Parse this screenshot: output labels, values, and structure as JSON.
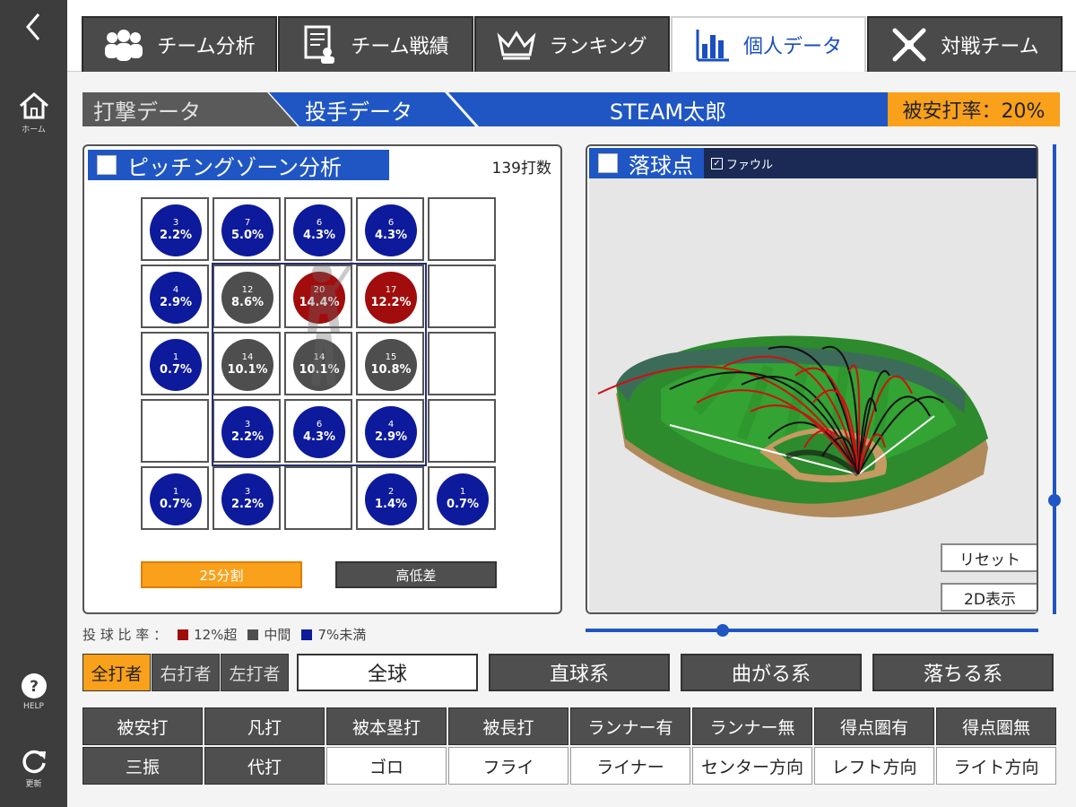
{
  "rail": {
    "home_label": "ホーム",
    "help_label": "HELP",
    "refresh_label": "更新"
  },
  "tabs": [
    {
      "label": "チーム分析",
      "icon": "team-icon"
    },
    {
      "label": "チーム戦績",
      "icon": "record-icon"
    },
    {
      "label": "ランキング",
      "icon": "crown-icon"
    },
    {
      "label": "個人データ",
      "icon": "bar-chart-icon"
    },
    {
      "label": "対戦チーム",
      "icon": "crossed-bats-icon"
    }
  ],
  "subbar": {
    "batting": "打撃データ",
    "pitching": "投手データ",
    "player": "STEAM太郎",
    "rate": "被安打率：20%"
  },
  "zone": {
    "title": "ピッチングゾーン分析",
    "count": "139打数",
    "rows": [
      [
        {
          "n": "3",
          "p": "2.2%",
          "c": "blue"
        },
        {
          "n": "7",
          "p": "5.0%",
          "c": "blue"
        },
        {
          "n": "6",
          "p": "4.3%",
          "c": "blue"
        },
        {
          "n": "6",
          "p": "4.3%",
          "c": "blue"
        },
        null
      ],
      [
        {
          "n": "4",
          "p": "2.9%",
          "c": "blue"
        },
        {
          "n": "12",
          "p": "8.6%",
          "c": "gray"
        },
        {
          "n": "20",
          "p": "14.4%",
          "c": "red"
        },
        {
          "n": "17",
          "p": "12.2%",
          "c": "red"
        },
        null
      ],
      [
        {
          "n": "1",
          "p": "0.7%",
          "c": "blue"
        },
        {
          "n": "14",
          "p": "10.1%",
          "c": "gray"
        },
        {
          "n": "14",
          "p": "10.1%",
          "c": "gray"
        },
        {
          "n": "15",
          "p": "10.8%",
          "c": "gray"
        },
        null
      ],
      [
        null,
        {
          "n": "3",
          "p": "2.2%",
          "c": "blue"
        },
        {
          "n": "6",
          "p": "4.3%",
          "c": "blue"
        },
        {
          "n": "4",
          "p": "2.9%",
          "c": "blue"
        },
        null
      ],
      [
        {
          "n": "1",
          "p": "0.7%",
          "c": "blue"
        },
        {
          "n": "3",
          "p": "2.2%",
          "c": "blue"
        },
        null,
        {
          "n": "2",
          "p": "1.4%",
          "c": "blue"
        },
        {
          "n": "1",
          "p": "0.7%",
          "c": "blue"
        }
      ]
    ],
    "btn_25": "25分割",
    "btn_height": "高低差"
  },
  "landing": {
    "title": "落球点",
    "foul_label": "ファウル",
    "foul_checked": true,
    "reset": "リセット",
    "view2d": "2D表示"
  },
  "legend": {
    "prefix": "投 球 比 率 ：",
    "over": "12%超",
    "middle": "中間",
    "under": "7%未満"
  },
  "colors": {
    "blue": "#0d1a9c",
    "gray": "#4e4e4e",
    "red": "#a10d0d",
    "accent": "#1f56c3",
    "orange": "#f9a11b"
  },
  "batters": [
    "全打者",
    "右打者",
    "左打者"
  ],
  "pitch_types": [
    "全球",
    "直球系",
    "曲がる系",
    "落ちる系"
  ],
  "results": {
    "row1": [
      "被安打",
      "凡打",
      "被本塁打",
      "被長打",
      "ランナー有",
      "ランナー無",
      "得点圏有",
      "得点圏無"
    ],
    "row2": [
      "三振",
      "代打",
      "ゴロ",
      "フライ",
      "ライナー",
      "センター方向",
      "レフト方向",
      "ライト方向"
    ]
  }
}
